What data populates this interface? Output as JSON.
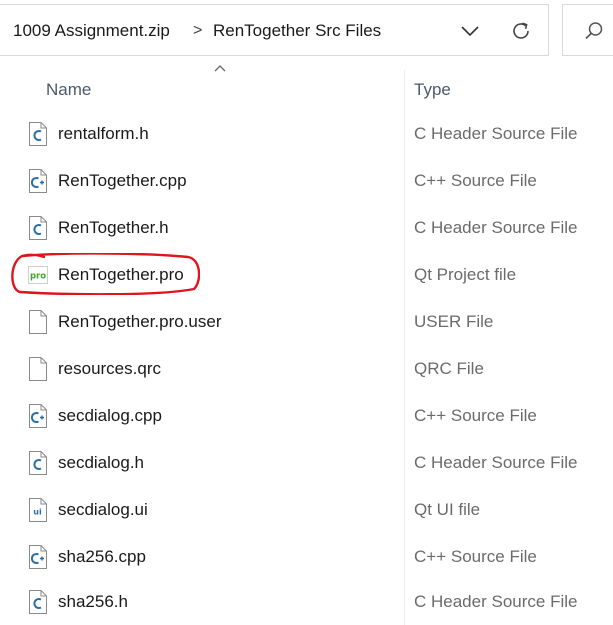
{
  "address": {
    "crumbs": [
      "1009 Assignment.zip",
      "RenTogether Src Files"
    ],
    "separator": ">"
  },
  "columns": {
    "name": "Name",
    "type": "Type"
  },
  "files": [
    {
      "name": "rentalform.h",
      "type": "C Header Source File",
      "icon": "c-header-file-icon"
    },
    {
      "name": "RenTogether.cpp",
      "type": "C++ Source File",
      "icon": "cpp-source-file-icon"
    },
    {
      "name": "RenTogether.h",
      "type": "C Header Source File",
      "icon": "c-header-file-icon"
    },
    {
      "name": "RenTogether.pro",
      "type": "Qt Project file",
      "icon": "qt-project-file-icon",
      "icon_text": "pro"
    },
    {
      "name": "RenTogether.pro.user",
      "type": "USER File",
      "icon": "generic-file-icon"
    },
    {
      "name": "resources.qrc",
      "type": "QRC File",
      "icon": "generic-file-icon"
    },
    {
      "name": "secdialog.cpp",
      "type": "C++ Source File",
      "icon": "cpp-source-file-icon"
    },
    {
      "name": "secdialog.h",
      "type": "C Header Source File",
      "icon": "c-header-file-icon"
    },
    {
      "name": "secdialog.ui",
      "type": "Qt UI file",
      "icon": "qt-ui-file-icon",
      "icon_text": "ui"
    },
    {
      "name": "sha256.cpp",
      "type": "C++ Source File",
      "icon": "cpp-source-file-icon"
    },
    {
      "name": "sha256.h",
      "type": "C Header Source File",
      "icon": "c-header-file-icon"
    }
  ],
  "colors": {
    "annotation": "#e0141c",
    "c_icon": "#2a6ea6",
    "qt_green": "#41a62a",
    "type_text": "#6b6b6b"
  }
}
